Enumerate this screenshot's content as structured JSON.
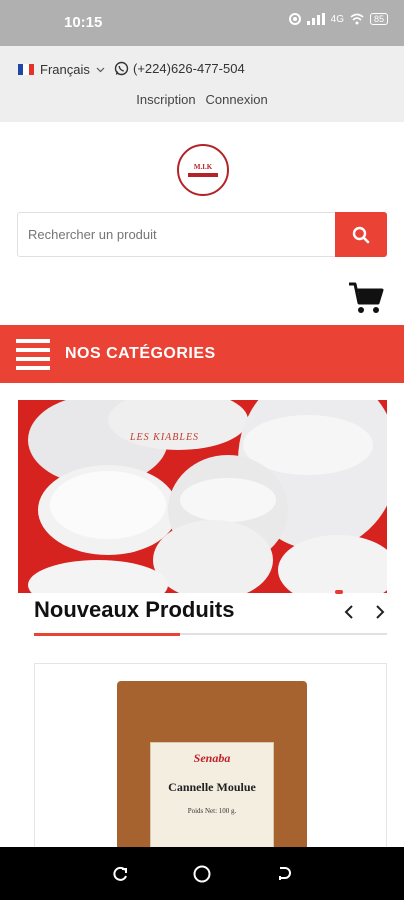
{
  "status_bar": {
    "time": "10:15",
    "battery": "85",
    "network": "4G"
  },
  "header": {
    "language": "Français",
    "phone": "(+224)626-477-504",
    "signup_label": "Inscription",
    "login_label": "Connexion"
  },
  "logo": {
    "text": "M.I.K"
  },
  "search": {
    "placeholder": "Rechercher un produit"
  },
  "categories": {
    "title": "NOS CATÉGORIES"
  },
  "banner": {
    "tag": "LES KIABLES"
  },
  "new_products": {
    "title": "Nouveaux Produits",
    "prev_icon": "chevron-left-icon",
    "next_icon": "chevron-right-icon"
  },
  "product": {
    "brand": "Senaba",
    "name": "Cannelle Moulue",
    "weight": "Poids Net: 100 g."
  },
  "colors": {
    "accent": "#ea4335",
    "status_bar": "#b0b0b0",
    "topbar": "#eeeeee"
  }
}
